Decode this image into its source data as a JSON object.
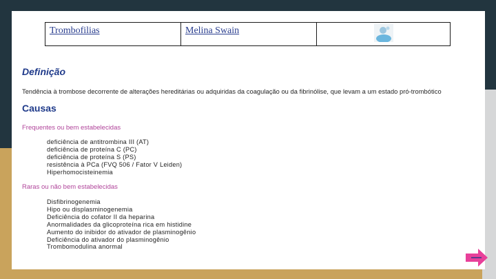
{
  "header": {
    "cell_1": "Trombofilias",
    "cell_2": "Melina Swain",
    "cell_3_icon": "user-avatar-icon"
  },
  "definicao": {
    "heading": "Definição",
    "text": "Tendência à trombose decorrente de alterações hereditárias ou adquiridas da coagulação ou da fibrinólise, que levam a um estado pró-trombótico"
  },
  "causas": {
    "heading": "Causas",
    "frequentes": {
      "label": "Frequentes ou bem estabelecidas",
      "items": [
        "deficiência de antitrombina III (AT)",
        "deficiência de proteína C (PC)",
        "deficiência de proteína S (PS)",
        "resistência à PCa (FVQ 506 / Fator V Leiden)",
        "Hiperhomocisteinemia"
      ]
    },
    "raras": {
      "label": "Raras ou não bem estabelecidas",
      "items": [
        "Disfibrinogenemia",
        "Hipo ou displasminogenemia",
        "Deficiência do cofator II da heparina",
        "Anormalidades da glicoproteína rica em histidine",
        "Aumento do inibidor do ativador de plasminogênio",
        "Deficiência do ativador do plasminogênio",
        "Trombomodulina anormal"
      ]
    }
  },
  "colors": {
    "heading_blue": "#1f3a8a",
    "sublabel_pink": "#b0449a",
    "arrow_pink": "#e8409a",
    "background_navy": "#22353f",
    "background_tan": "#c9a35c"
  },
  "nav": {
    "next_icon": "arrow-right-icon"
  }
}
